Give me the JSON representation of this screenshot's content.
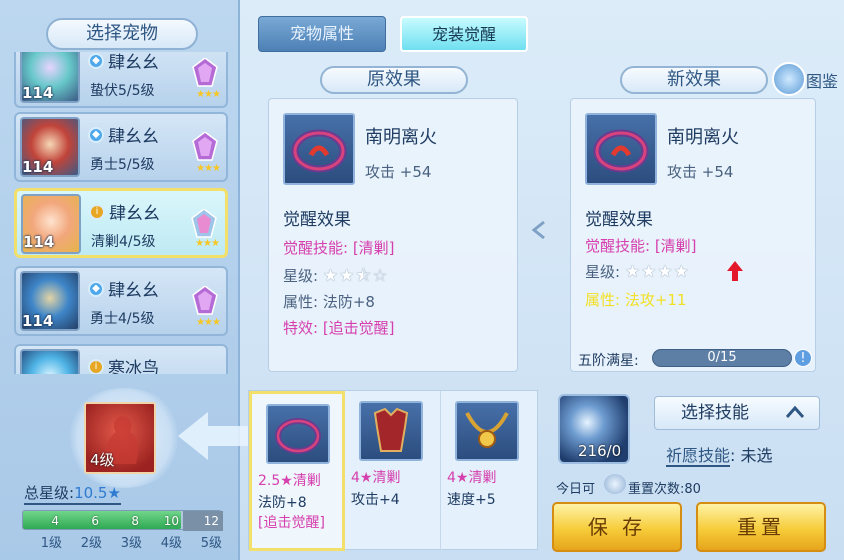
{
  "left": {
    "title": "选择宠物",
    "pets": [
      {
        "level": "114",
        "name": "肆幺幺",
        "sub": "蛰伏5/5级",
        "class": "water"
      },
      {
        "level": "114",
        "name": "肆幺幺",
        "sub": "勇士5/5级",
        "class": "water"
      },
      {
        "level": "114",
        "name": "肆幺幺",
        "sub": "清剿4/5级",
        "class": "gold",
        "selected": true
      },
      {
        "level": "114",
        "name": "肆幺幺",
        "sub": "勇士4/5级",
        "class": "water"
      },
      {
        "level": "",
        "name": "寒冰鸟",
        "sub": "",
        "class": "gold"
      }
    ],
    "equip_level": "4级",
    "total_star_label": "总星级:",
    "total_star_value": "10.5★",
    "star_ticks": [
      "4",
      "6",
      "8",
      "10",
      "12"
    ],
    "star_progress": 0.8,
    "level_labels": [
      "1级",
      "2级",
      "3级",
      "4级",
      "5级"
    ]
  },
  "tabs": {
    "attr": "宠物属性",
    "awaken": "宠装觉醒"
  },
  "original": {
    "header": "原效果",
    "item_name": "南明离火",
    "attack": "攻击 +54",
    "awaken_title": "觉醒效果",
    "skill": "觉醒技能: [清剿]",
    "star_label": "星级:",
    "stars": "★★⯪☆",
    "attr": "属性: 法防+8",
    "special": "特效: [追击觉醒]"
  },
  "new": {
    "header": "新效果",
    "atlas": "图鉴",
    "item_name": "南明离火",
    "attack": "攻击 +54",
    "awaken_title": "觉醒效果",
    "skill": "觉醒技能: [清剿]",
    "star_label": "星级:",
    "stars": "★★★★",
    "attr": "属性: 法攻+11",
    "full_star_label": "五阶满星:",
    "full_star_value": "0/15",
    "info": "!"
  },
  "slots": [
    {
      "title": "2.5★清剿",
      "attr": "法防+8",
      "extra": "[追击觉醒]",
      "selected": true
    },
    {
      "title": "4★清剿",
      "attr": "攻击+4",
      "extra": ""
    },
    {
      "title": "4★清剿",
      "attr": "速度+5",
      "extra": ""
    }
  ],
  "right": {
    "orb_count": "216/0",
    "skill_select": "选择技能",
    "wish_label": "祈愿技能",
    "wish_value": ": 未选",
    "today": "今日可",
    "reset_count": "重置次数:80",
    "save": "保 存",
    "reset": "重置"
  },
  "colors": {
    "accent_pink": "#d63fae",
    "accent_yellow": "#f2e024",
    "button_gold": "#f6cc3a"
  }
}
